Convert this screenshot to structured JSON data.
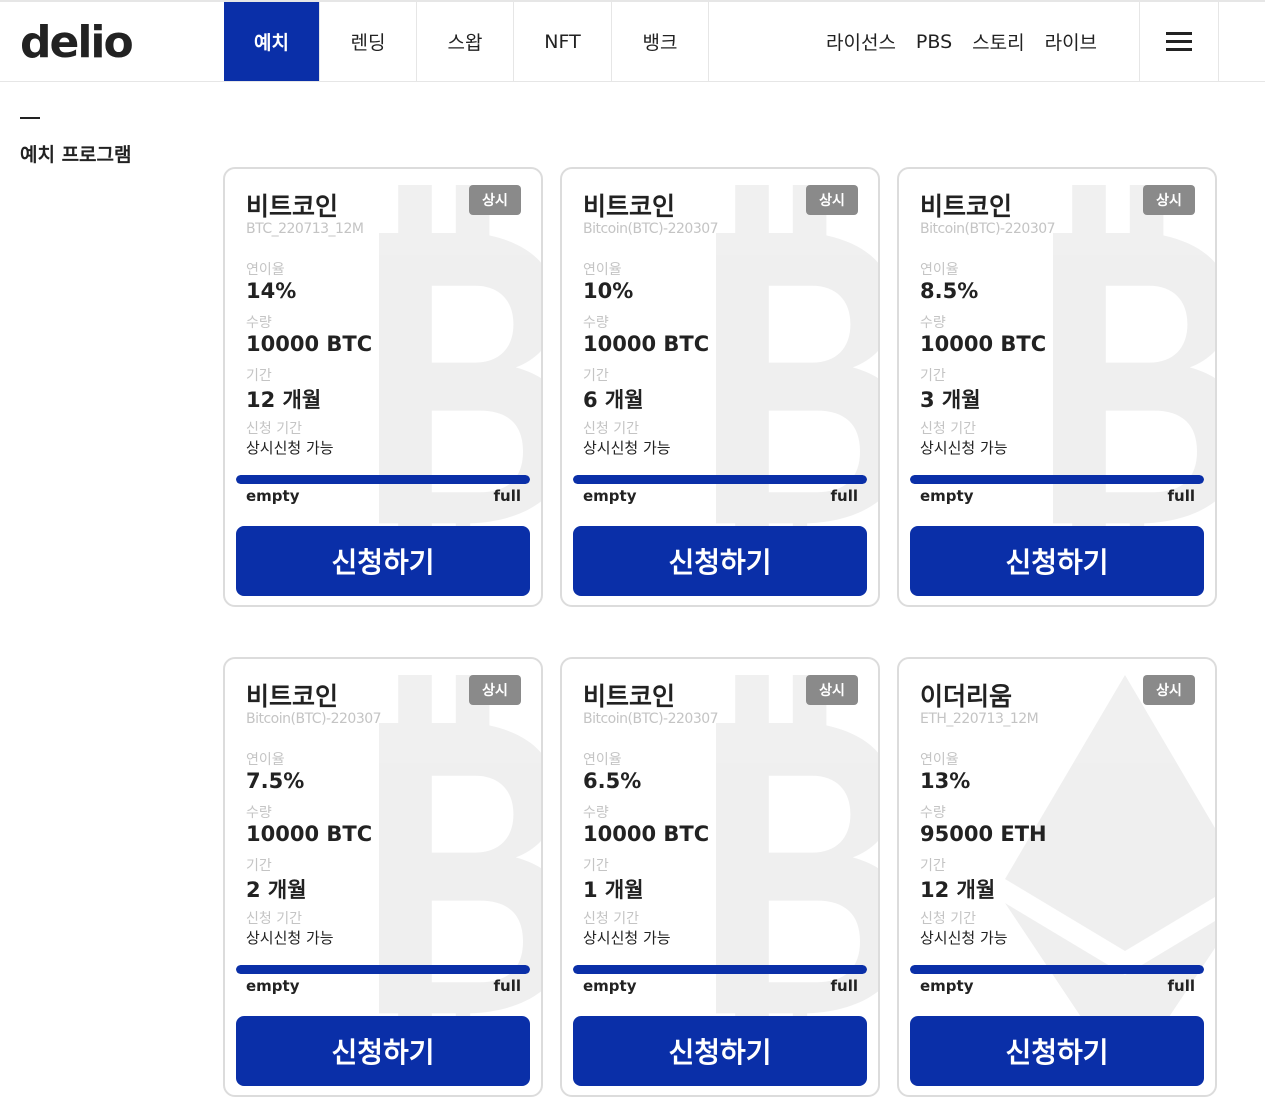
{
  "header": {
    "logo": "delio",
    "nav": [
      {
        "label": "예치",
        "active": true
      },
      {
        "label": "렌딩",
        "active": false
      },
      {
        "label": "스왑",
        "active": false
      },
      {
        "label": "NFT",
        "active": false
      },
      {
        "label": "뱅크",
        "active": false
      }
    ],
    "nav_right": [
      "라이선스",
      "PBS",
      "스토리",
      "라이브"
    ],
    "menu_icon": "hamburger-menu-icon"
  },
  "section": {
    "title": "예치 프로그램"
  },
  "field_labels": {
    "rate": "연이율",
    "amount": "수량",
    "period": "기간",
    "apply_period": "신청 기간"
  },
  "progress_labels": {
    "empty": "empty",
    "full": "full"
  },
  "apply_label": "신청하기",
  "accent_color": "#0a2fa8",
  "cards": [
    {
      "name": "비트코인",
      "code": "BTC_220713_12M",
      "badge": "상시",
      "rate": "14%",
      "amount": "10000 BTC",
      "period": "12 개월",
      "apply_period": "상시신청 가능",
      "progress": 1.0,
      "watermark": "bitcoin-icon"
    },
    {
      "name": "비트코인",
      "code": "Bitcoin(BTC)-220307",
      "badge": "상시",
      "rate": "10%",
      "amount": "10000 BTC",
      "period": "6 개월",
      "apply_period": "상시신청 가능",
      "progress": 1.0,
      "watermark": "bitcoin-icon"
    },
    {
      "name": "비트코인",
      "code": "Bitcoin(BTC)-220307",
      "badge": "상시",
      "rate": "8.5%",
      "amount": "10000 BTC",
      "period": "3 개월",
      "apply_period": "상시신청 가능",
      "progress": 1.0,
      "watermark": "bitcoin-icon"
    },
    {
      "name": "비트코인",
      "code": "Bitcoin(BTC)-220307",
      "badge": "상시",
      "rate": "7.5%",
      "amount": "10000 BTC",
      "period": "2 개월",
      "apply_period": "상시신청 가능",
      "progress": 1.0,
      "watermark": "bitcoin-icon"
    },
    {
      "name": "비트코인",
      "code": "Bitcoin(BTC)-220307",
      "badge": "상시",
      "rate": "6.5%",
      "amount": "10000 BTC",
      "period": "1 개월",
      "apply_period": "상시신청 가능",
      "progress": 1.0,
      "watermark": "bitcoin-icon"
    },
    {
      "name": "이더리움",
      "code": "ETH_220713_12M",
      "badge": "상시",
      "rate": "13%",
      "amount": "95000 ETH",
      "period": "12 개월",
      "apply_period": "상시신청 가능",
      "progress": 1.0,
      "watermark": "ethereum-icon"
    }
  ]
}
